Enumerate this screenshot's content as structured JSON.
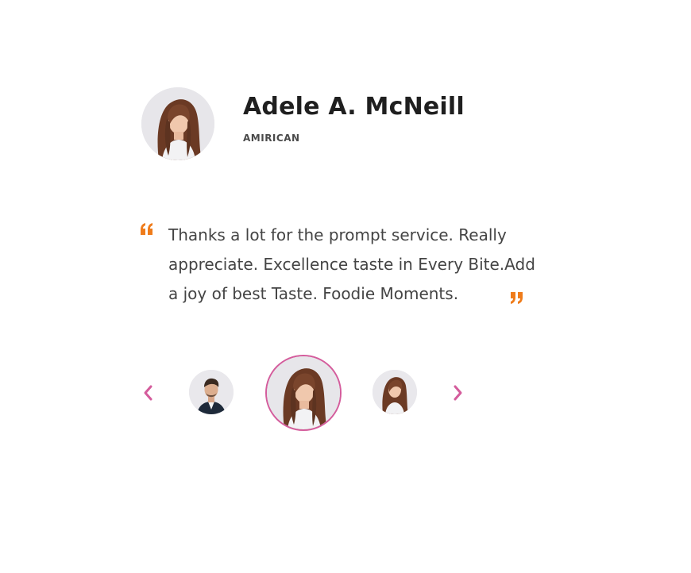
{
  "testimonial": {
    "name": "Adele A. McNeill",
    "country": "AMIRICAN",
    "quote_lines": [
      "Thanks a lot for the prompt service. Really",
      "appreciate. Excellence taste in Every Bite.Add",
      "a joy of best Taste. Foodie Moments."
    ]
  },
  "carousel": {
    "prev_icon": "chevron-left-icon",
    "next_icon": "chevron-right-icon",
    "active_index": 1,
    "avatars": [
      "man-avatar",
      "woman-avatar",
      "woman-avatar"
    ]
  },
  "colors": {
    "accent_pink": "#d45c9c",
    "quote_orange": "#ef7c1b",
    "text_dark": "#1f1f1f",
    "text_body": "#444444"
  }
}
